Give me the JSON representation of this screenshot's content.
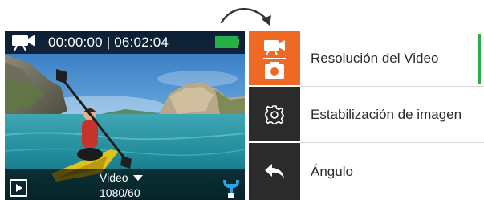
{
  "preview": {
    "timer": "00:00:00 | 06:02:04",
    "mode_label": "Video",
    "resolution": "1080/60",
    "battery_color": "#27b045"
  },
  "menu": {
    "accent_color": "#ee6a24",
    "indicator_color": "#27b045",
    "items": [
      {
        "label": "Resolución del Video",
        "icon": "video-photo-mode-icon",
        "active": true
      },
      {
        "label": "Estabilización de imagen",
        "icon": "gear-icon",
        "active": false
      },
      {
        "label": "Ángulo",
        "icon": "back-arrow-icon",
        "active": false
      }
    ]
  },
  "icons": {
    "hint_arrow": "curved-arrow-icon",
    "status_camera": "video-camera-icon",
    "battery": "battery-icon",
    "play": "playback-icon",
    "dropdown": "caret-down-icon",
    "settings": "wrench-icon"
  }
}
